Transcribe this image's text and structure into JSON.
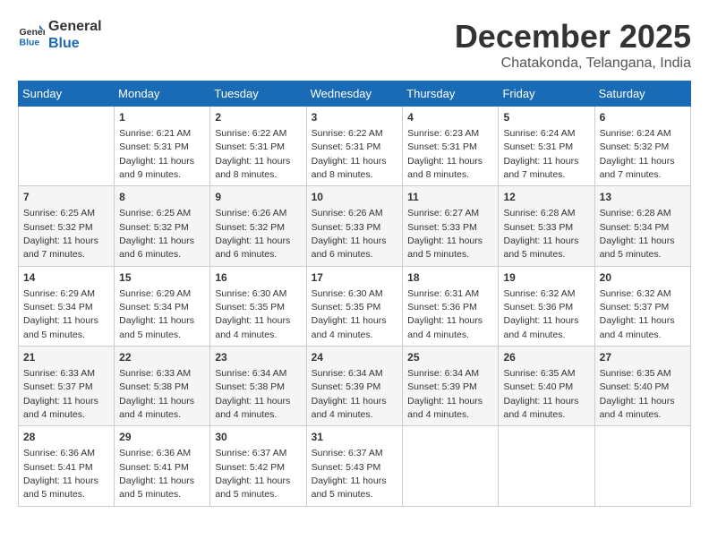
{
  "logo": {
    "line1": "General",
    "line2": "Blue"
  },
  "title": "December 2025",
  "location": "Chatakonda, Telangana, India",
  "days_of_week": [
    "Sunday",
    "Monday",
    "Tuesday",
    "Wednesday",
    "Thursday",
    "Friday",
    "Saturday"
  ],
  "weeks": [
    [
      {
        "day": "",
        "sunrise": "",
        "sunset": "",
        "daylight": ""
      },
      {
        "day": "1",
        "sunrise": "Sunrise: 6:21 AM",
        "sunset": "Sunset: 5:31 PM",
        "daylight": "Daylight: 11 hours and 9 minutes."
      },
      {
        "day": "2",
        "sunrise": "Sunrise: 6:22 AM",
        "sunset": "Sunset: 5:31 PM",
        "daylight": "Daylight: 11 hours and 8 minutes."
      },
      {
        "day": "3",
        "sunrise": "Sunrise: 6:22 AM",
        "sunset": "Sunset: 5:31 PM",
        "daylight": "Daylight: 11 hours and 8 minutes."
      },
      {
        "day": "4",
        "sunrise": "Sunrise: 6:23 AM",
        "sunset": "Sunset: 5:31 PM",
        "daylight": "Daylight: 11 hours and 8 minutes."
      },
      {
        "day": "5",
        "sunrise": "Sunrise: 6:24 AM",
        "sunset": "Sunset: 5:31 PM",
        "daylight": "Daylight: 11 hours and 7 minutes."
      },
      {
        "day": "6",
        "sunrise": "Sunrise: 6:24 AM",
        "sunset": "Sunset: 5:32 PM",
        "daylight": "Daylight: 11 hours and 7 minutes."
      }
    ],
    [
      {
        "day": "7",
        "sunrise": "Sunrise: 6:25 AM",
        "sunset": "Sunset: 5:32 PM",
        "daylight": "Daylight: 11 hours and 7 minutes."
      },
      {
        "day": "8",
        "sunrise": "Sunrise: 6:25 AM",
        "sunset": "Sunset: 5:32 PM",
        "daylight": "Daylight: 11 hours and 6 minutes."
      },
      {
        "day": "9",
        "sunrise": "Sunrise: 6:26 AM",
        "sunset": "Sunset: 5:32 PM",
        "daylight": "Daylight: 11 hours and 6 minutes."
      },
      {
        "day": "10",
        "sunrise": "Sunrise: 6:26 AM",
        "sunset": "Sunset: 5:33 PM",
        "daylight": "Daylight: 11 hours and 6 minutes."
      },
      {
        "day": "11",
        "sunrise": "Sunrise: 6:27 AM",
        "sunset": "Sunset: 5:33 PM",
        "daylight": "Daylight: 11 hours and 5 minutes."
      },
      {
        "day": "12",
        "sunrise": "Sunrise: 6:28 AM",
        "sunset": "Sunset: 5:33 PM",
        "daylight": "Daylight: 11 hours and 5 minutes."
      },
      {
        "day": "13",
        "sunrise": "Sunrise: 6:28 AM",
        "sunset": "Sunset: 5:34 PM",
        "daylight": "Daylight: 11 hours and 5 minutes."
      }
    ],
    [
      {
        "day": "14",
        "sunrise": "Sunrise: 6:29 AM",
        "sunset": "Sunset: 5:34 PM",
        "daylight": "Daylight: 11 hours and 5 minutes."
      },
      {
        "day": "15",
        "sunrise": "Sunrise: 6:29 AM",
        "sunset": "Sunset: 5:34 PM",
        "daylight": "Daylight: 11 hours and 5 minutes."
      },
      {
        "day": "16",
        "sunrise": "Sunrise: 6:30 AM",
        "sunset": "Sunset: 5:35 PM",
        "daylight": "Daylight: 11 hours and 4 minutes."
      },
      {
        "day": "17",
        "sunrise": "Sunrise: 6:30 AM",
        "sunset": "Sunset: 5:35 PM",
        "daylight": "Daylight: 11 hours and 4 minutes."
      },
      {
        "day": "18",
        "sunrise": "Sunrise: 6:31 AM",
        "sunset": "Sunset: 5:36 PM",
        "daylight": "Daylight: 11 hours and 4 minutes."
      },
      {
        "day": "19",
        "sunrise": "Sunrise: 6:32 AM",
        "sunset": "Sunset: 5:36 PM",
        "daylight": "Daylight: 11 hours and 4 minutes."
      },
      {
        "day": "20",
        "sunrise": "Sunrise: 6:32 AM",
        "sunset": "Sunset: 5:37 PM",
        "daylight": "Daylight: 11 hours and 4 minutes."
      }
    ],
    [
      {
        "day": "21",
        "sunrise": "Sunrise: 6:33 AM",
        "sunset": "Sunset: 5:37 PM",
        "daylight": "Daylight: 11 hours and 4 minutes."
      },
      {
        "day": "22",
        "sunrise": "Sunrise: 6:33 AM",
        "sunset": "Sunset: 5:38 PM",
        "daylight": "Daylight: 11 hours and 4 minutes."
      },
      {
        "day": "23",
        "sunrise": "Sunrise: 6:34 AM",
        "sunset": "Sunset: 5:38 PM",
        "daylight": "Daylight: 11 hours and 4 minutes."
      },
      {
        "day": "24",
        "sunrise": "Sunrise: 6:34 AM",
        "sunset": "Sunset: 5:39 PM",
        "daylight": "Daylight: 11 hours and 4 minutes."
      },
      {
        "day": "25",
        "sunrise": "Sunrise: 6:34 AM",
        "sunset": "Sunset: 5:39 PM",
        "daylight": "Daylight: 11 hours and 4 minutes."
      },
      {
        "day": "26",
        "sunrise": "Sunrise: 6:35 AM",
        "sunset": "Sunset: 5:40 PM",
        "daylight": "Daylight: 11 hours and 4 minutes."
      },
      {
        "day": "27",
        "sunrise": "Sunrise: 6:35 AM",
        "sunset": "Sunset: 5:40 PM",
        "daylight": "Daylight: 11 hours and 4 minutes."
      }
    ],
    [
      {
        "day": "28",
        "sunrise": "Sunrise: 6:36 AM",
        "sunset": "Sunset: 5:41 PM",
        "daylight": "Daylight: 11 hours and 5 minutes."
      },
      {
        "day": "29",
        "sunrise": "Sunrise: 6:36 AM",
        "sunset": "Sunset: 5:41 PM",
        "daylight": "Daylight: 11 hours and 5 minutes."
      },
      {
        "day": "30",
        "sunrise": "Sunrise: 6:37 AM",
        "sunset": "Sunset: 5:42 PM",
        "daylight": "Daylight: 11 hours and 5 minutes."
      },
      {
        "day": "31",
        "sunrise": "Sunrise: 6:37 AM",
        "sunset": "Sunset: 5:43 PM",
        "daylight": "Daylight: 11 hours and 5 minutes."
      },
      {
        "day": "",
        "sunrise": "",
        "sunset": "",
        "daylight": ""
      },
      {
        "day": "",
        "sunrise": "",
        "sunset": "",
        "daylight": ""
      },
      {
        "day": "",
        "sunrise": "",
        "sunset": "",
        "daylight": ""
      }
    ]
  ]
}
